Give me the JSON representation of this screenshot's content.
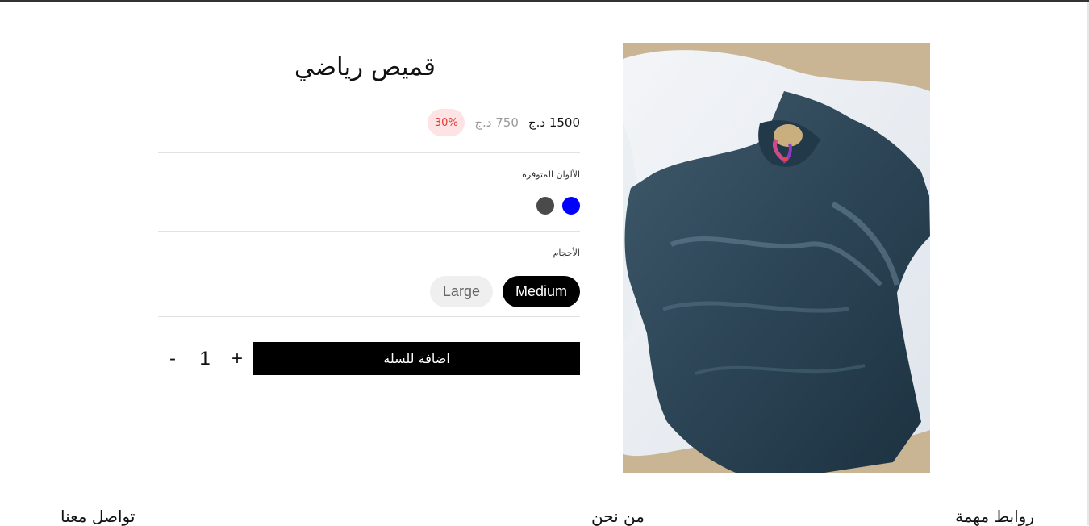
{
  "product": {
    "title": "قميص رياضي",
    "price_current": "1500 د.ج",
    "price_old": "750 د.ج",
    "discount": "30%"
  },
  "colors": {
    "label": "الألوان المتوفرة",
    "options": [
      {
        "name": "blue",
        "hex": "#0000ff"
      },
      {
        "name": "dark-gray",
        "hex": "#4a4a4a"
      }
    ]
  },
  "sizes": {
    "label": "الأحجام",
    "options": [
      "Medium",
      "Large"
    ],
    "selected": "Medium"
  },
  "cart": {
    "add_label": "اضافة للسلة",
    "quantity": "1",
    "increment": "+",
    "decrement": "-"
  },
  "footer": {
    "links_heading": "روابط مهمة",
    "about_heading": "من نحن",
    "contact_heading": "تواصل معنا"
  }
}
